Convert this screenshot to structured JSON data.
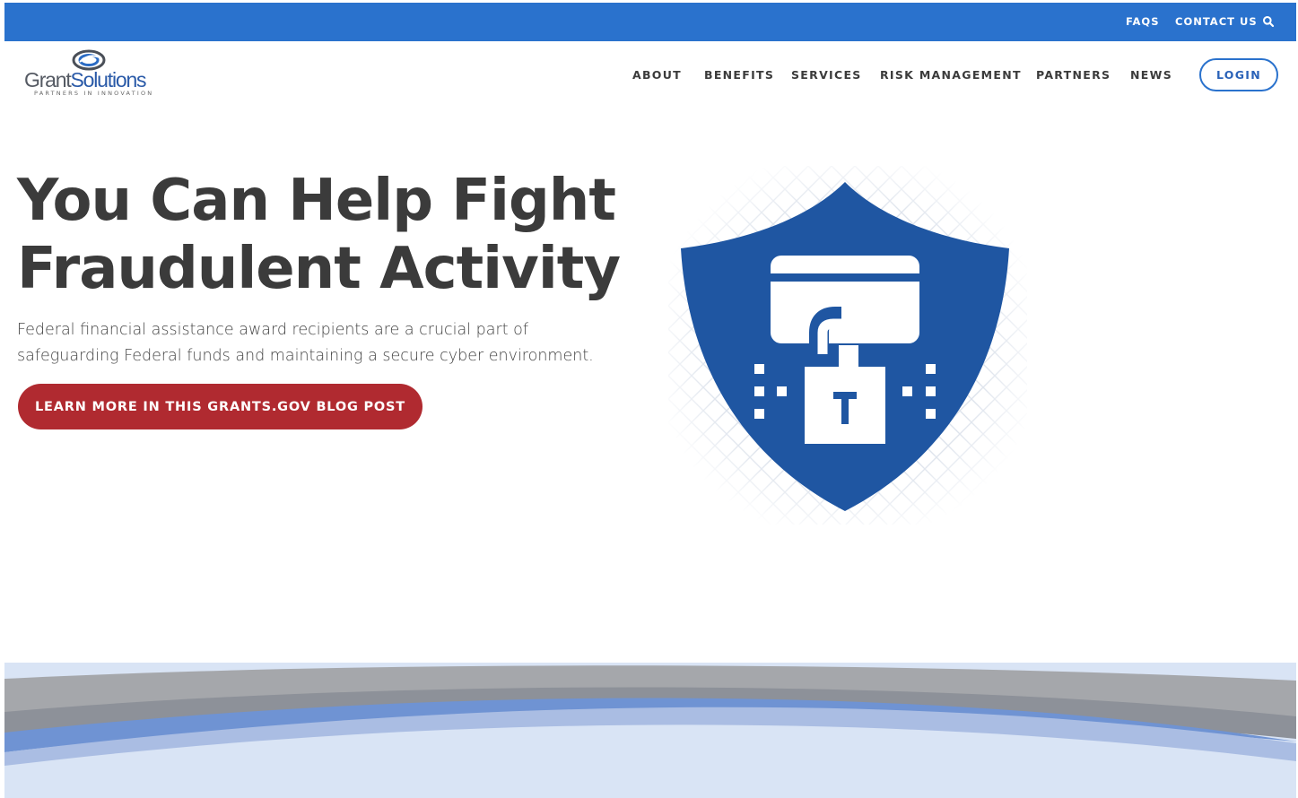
{
  "topbar": {
    "faqs": "FAQS",
    "contact": "CONTACT US",
    "search_icon": "search-icon",
    "bg_color": "#2a72cd"
  },
  "logo": {
    "grant": "Grant",
    "solutions": "Solutions",
    "tagline": "PARTNERS IN INNOVATION"
  },
  "nav": {
    "items": [
      {
        "label": "ABOUT"
      },
      {
        "label": "BENEFITS"
      },
      {
        "label": "SERVICES"
      },
      {
        "label": "RISK MANAGEMENT"
      },
      {
        "label": "PARTNERS"
      },
      {
        "label": "NEWS"
      }
    ],
    "login": "LOGIN"
  },
  "hero": {
    "title_line1": "You Can Help Fight",
    "title_line2": "Fraudulent Activity",
    "text": "Federal financial assistance award recipients are a crucial part of safeguarding Federal funds and maintaining a secure cyber environment.",
    "cta": "LEARN MORE IN THIS GRANTS.GOV BLOG POST",
    "illustration_icon": "shield-lock-icon"
  },
  "colors": {
    "accent_blue": "#2a72cd",
    "shield_blue": "#1f56a2",
    "cta_red": "#b02a30",
    "heading": "#3b3b3b"
  }
}
